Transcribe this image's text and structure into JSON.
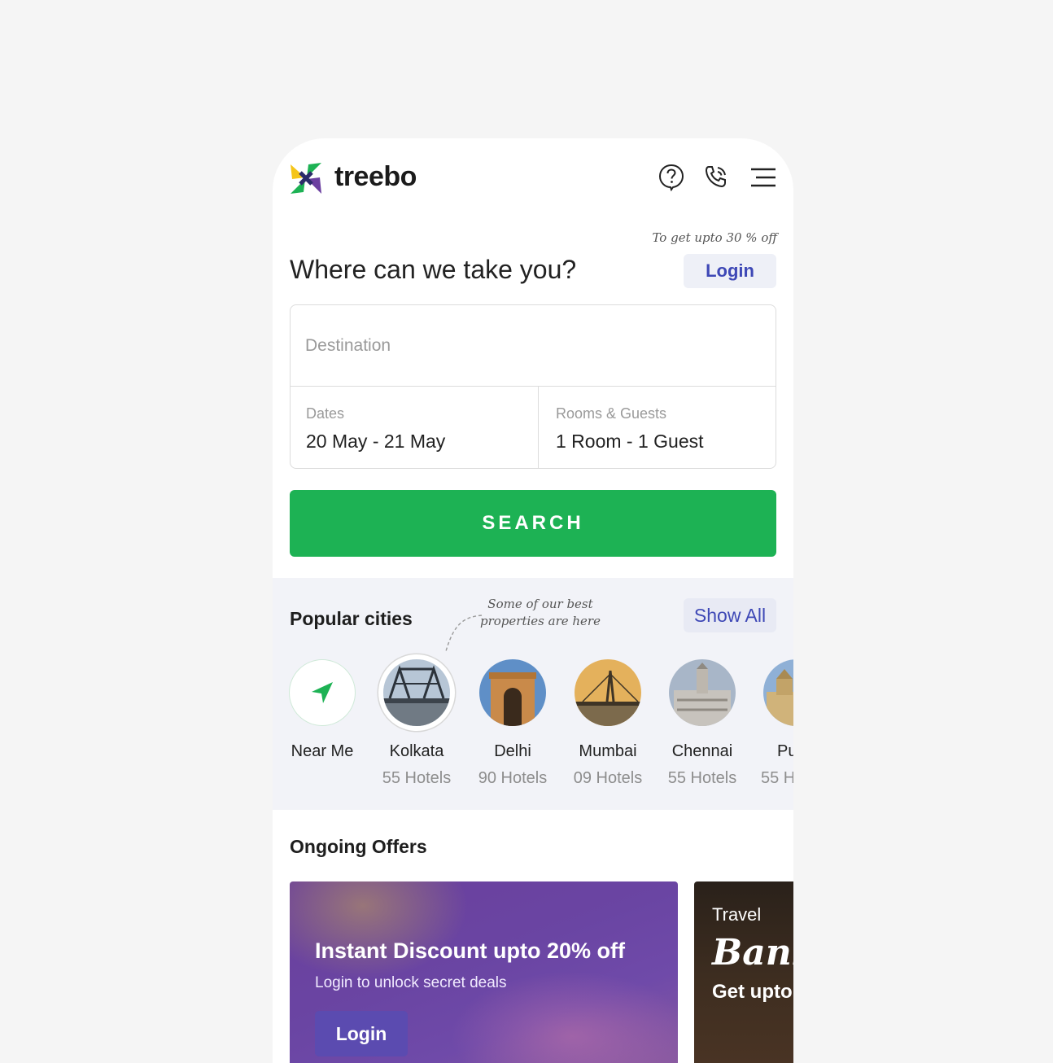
{
  "header": {
    "brand": "treebo",
    "icons": [
      "help-icon",
      "phone-icon",
      "menu-icon"
    ]
  },
  "hero": {
    "promo_note": "To get upto 30 % off",
    "title": "Where can we take you?",
    "login_label": "Login"
  },
  "search": {
    "destination_placeholder": "Destination",
    "dates_label": "Dates",
    "dates_value": "20 May - 21 May",
    "rooms_label": "Rooms & Guests",
    "rooms_value": "1 Room - 1 Guest",
    "button_label": "SEARCH"
  },
  "popular_cities": {
    "title": "Popular cities",
    "note_line1": "Some of our best",
    "note_line2": "properties are here",
    "show_all_label": "Show All",
    "items": [
      {
        "name": "Near Me",
        "count": ""
      },
      {
        "name": "Kolkata",
        "count": "55 Hotels"
      },
      {
        "name": "Delhi",
        "count": "90 Hotels"
      },
      {
        "name": "Mumbai",
        "count": "09 Hotels"
      },
      {
        "name": "Chennai",
        "count": "55 Hotels"
      },
      {
        "name": "Pu",
        "count": "55 H"
      }
    ]
  },
  "offers": {
    "title": "Ongoing Offers",
    "cards": [
      {
        "title": "Instant Discount upto 20% off",
        "subtitle": "Login to unlock secret deals",
        "button_label": "Login"
      },
      {
        "eyebrow": "Travel",
        "brand": "Bank",
        "subtitle": "Get upto"
      }
    ]
  },
  "colors": {
    "accent_green": "#1db254",
    "link_blue": "#3e48b6",
    "offer_purple": "#6a45a3"
  }
}
